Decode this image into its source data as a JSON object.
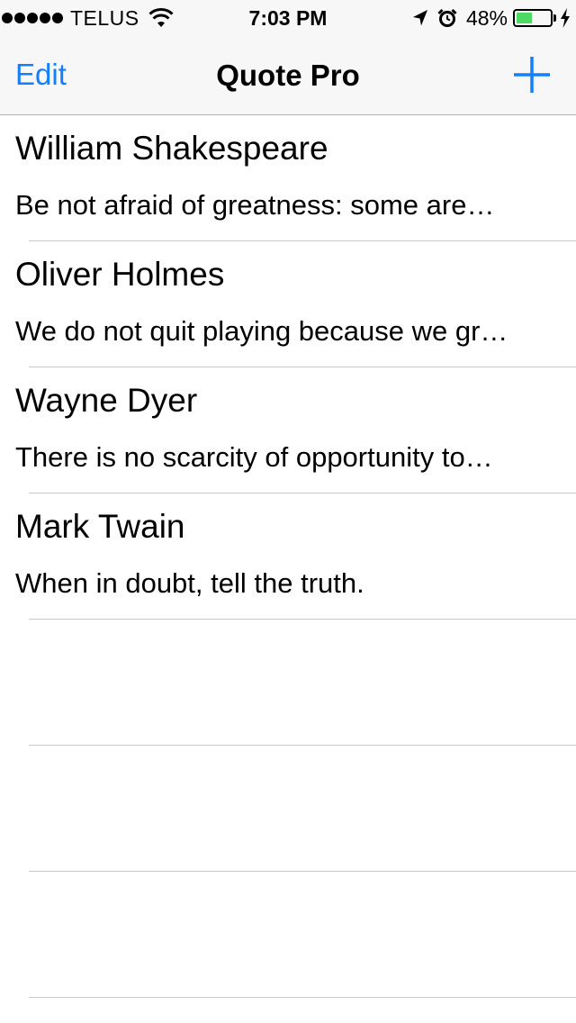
{
  "status_bar": {
    "carrier": "TELUS",
    "time": "7:03 PM",
    "battery_percent": "48%",
    "battery_level": 0.48,
    "icons": [
      "signal-dots-icon",
      "wifi-icon",
      "location-arrow-icon",
      "alarm-clock-icon",
      "battery-icon",
      "charging-bolt-icon"
    ],
    "battery_color": "#4cd964"
  },
  "nav": {
    "edit_label": "Edit",
    "title": "Quote Pro",
    "add_icon": "plus-icon",
    "accent_color": "#147efb"
  },
  "quotes": [
    {
      "author": "William Shakespeare",
      "preview": "Be not afraid of greatness: some are…"
    },
    {
      "author": "Oliver Holmes",
      "preview": "We do not quit playing because we gr…"
    },
    {
      "author": "Wayne Dyer",
      "preview": "There is no scarcity of opportunity to…"
    },
    {
      "author": "Mark Twain",
      "preview": "When in doubt, tell the truth."
    }
  ]
}
